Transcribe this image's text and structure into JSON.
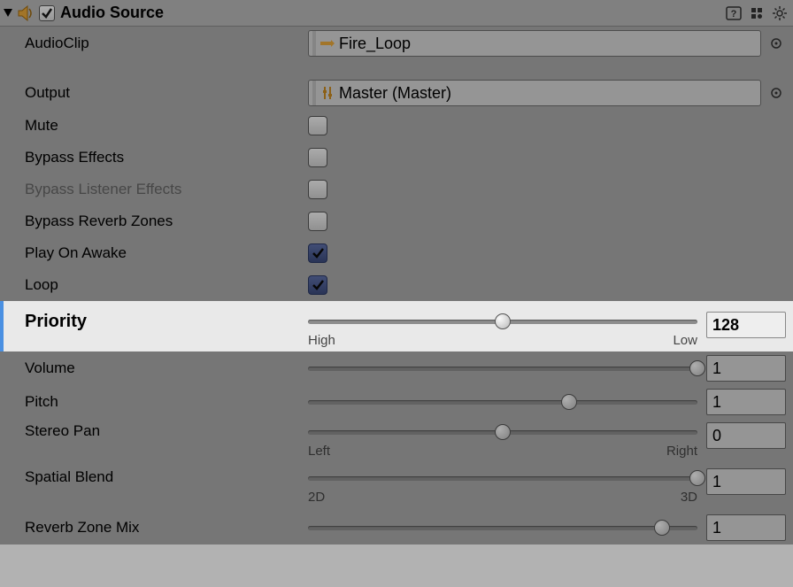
{
  "header": {
    "title": "Audio Source",
    "enabled": true
  },
  "fields": {
    "audioClip": {
      "label": "AudioClip",
      "value": "Fire_Loop"
    },
    "output": {
      "label": "Output",
      "value": "Master (Master)"
    },
    "mute": {
      "label": "Mute",
      "checked": false
    },
    "bypassEffects": {
      "label": "Bypass Effects",
      "checked": false
    },
    "bypassListener": {
      "label": "Bypass Listener Effects",
      "checked": false,
      "disabled": true
    },
    "bypassReverb": {
      "label": "Bypass Reverb Zones",
      "checked": false
    },
    "playOnAwake": {
      "label": "Play On Awake",
      "checked": true
    },
    "loop": {
      "label": "Loop",
      "checked": true
    },
    "priority": {
      "label": "Priority",
      "value": "128",
      "pct": 50,
      "minLabel": "High",
      "maxLabel": "Low"
    },
    "volume": {
      "label": "Volume",
      "value": "1",
      "pct": 100
    },
    "pitch": {
      "label": "Pitch",
      "value": "1",
      "pct": 67
    },
    "stereoPan": {
      "label": "Stereo Pan",
      "value": "0",
      "pct": 50,
      "minLabel": "Left",
      "maxLabel": "Right"
    },
    "spatialBlend": {
      "label": "Spatial Blend",
      "value": "1",
      "pct": 100,
      "minLabel": "2D",
      "maxLabel": "3D"
    },
    "reverbMix": {
      "label": "Reverb Zone Mix",
      "value": "1",
      "pct": 91
    }
  }
}
